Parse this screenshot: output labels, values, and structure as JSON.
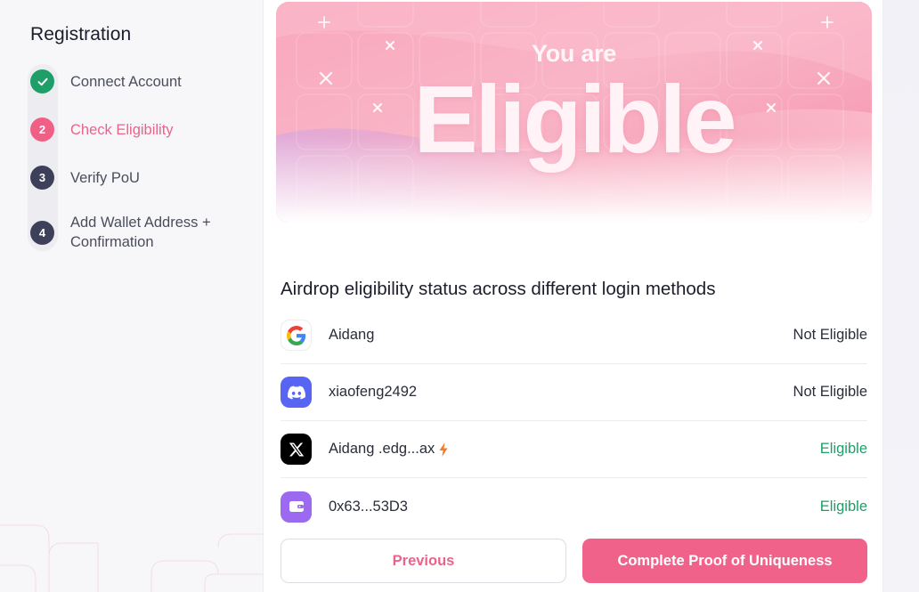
{
  "sidebar": {
    "title": "Registration",
    "steps": [
      {
        "number": "",
        "label": "Connect Account",
        "state": "done"
      },
      {
        "number": "2",
        "label": "Check Eligibility",
        "state": "active"
      },
      {
        "number": "3",
        "label": "Verify PoU",
        "state": "todo"
      },
      {
        "number": "4",
        "label": "Add Wallet Address + Confirmation",
        "state": "todo"
      }
    ]
  },
  "hero": {
    "subtitle": "You are",
    "title": "Eligible"
  },
  "section": {
    "title": "Airdrop eligibility status across different login methods"
  },
  "methods": [
    {
      "icon": "google-icon",
      "name": "Aidang",
      "status": "Not Eligible",
      "eligible": false
    },
    {
      "icon": "discord-icon",
      "name": "xiaofeng2492",
      "status": "Not Eligible",
      "eligible": false
    },
    {
      "icon": "x-icon",
      "name": "Aidang .edg...ax",
      "status": "Eligible",
      "eligible": true,
      "badge": "bolt-icon"
    },
    {
      "icon": "wallet-icon",
      "name": "0x63...53D3",
      "status": "Eligible",
      "eligible": true
    }
  ],
  "buttons": {
    "previous": "Previous",
    "next": "Complete Proof of Uniqueness"
  },
  "colors": {
    "accent": "#f0628a",
    "eligible": "#1e9e68",
    "step_todo": "#3d4058",
    "discord": "#5865f2",
    "wallet": "#9b6af0"
  }
}
